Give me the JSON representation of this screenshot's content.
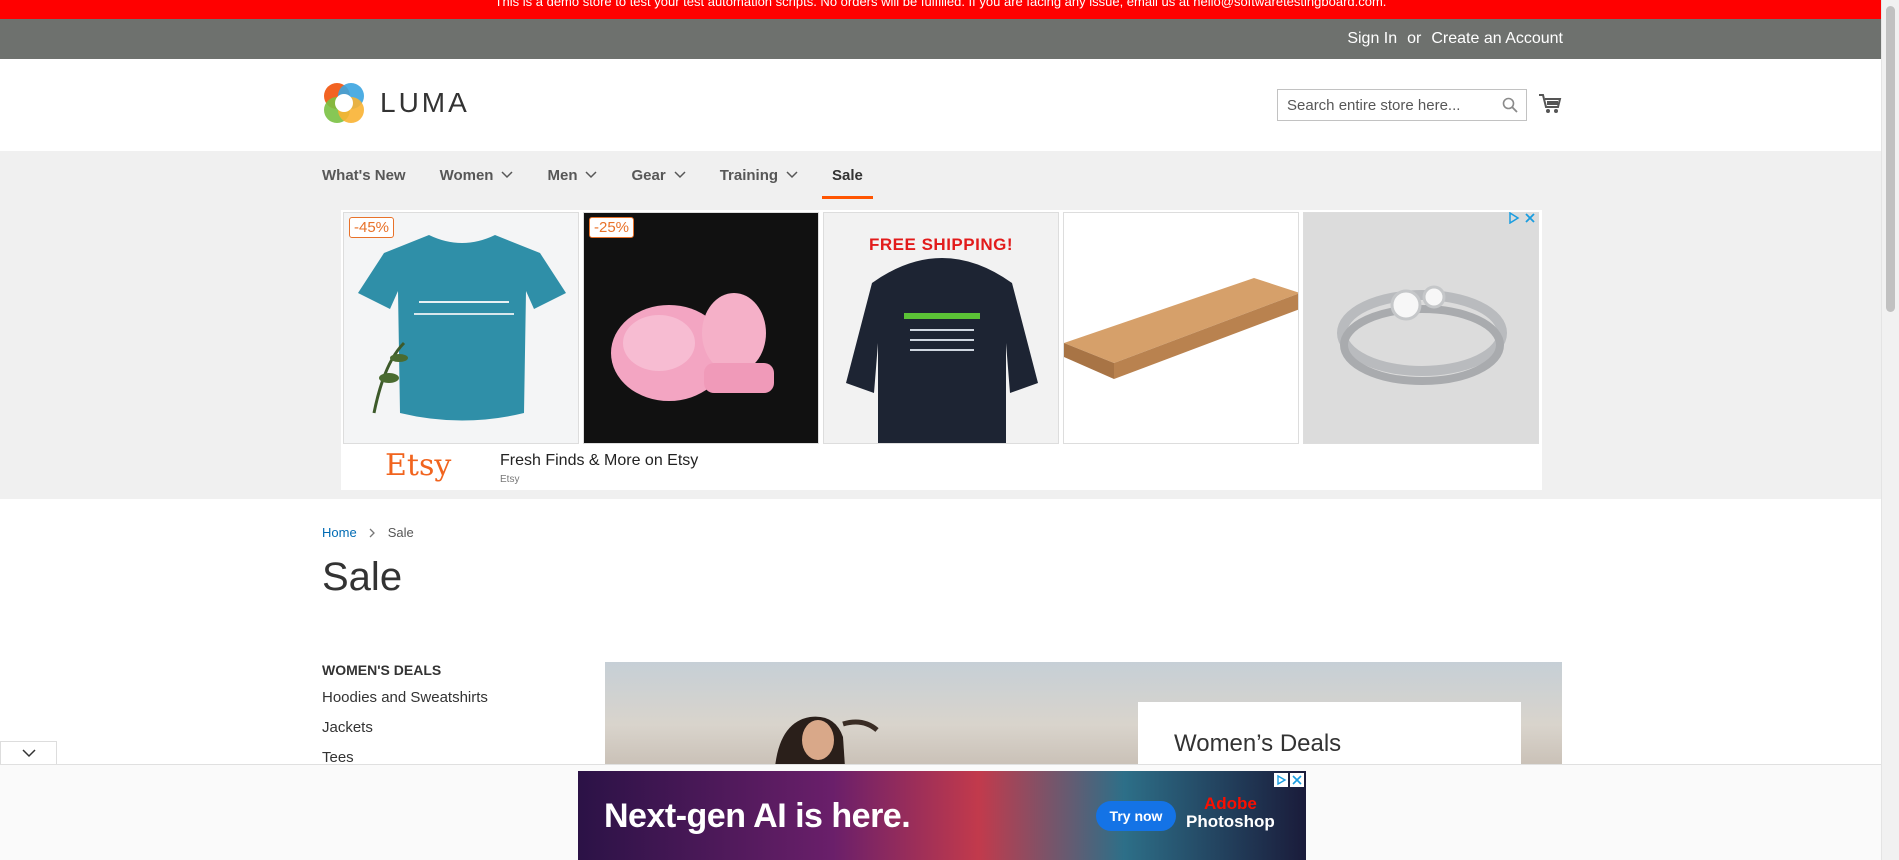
{
  "demo_notice": "This is a demo store to test your test automation scripts. No orders will be fulfilled. If you are facing any issue, email us at hello@softwaretestingboard.com.",
  "top_links": {
    "sign_in": "Sign In",
    "or": "or",
    "create_account": "Create an Account"
  },
  "header": {
    "logo_text": "LUMA",
    "search": {
      "placeholder": "Search entire store here...",
      "value": ""
    }
  },
  "nav": {
    "items": [
      {
        "label": "What's New",
        "dropdown": false
      },
      {
        "label": "Women",
        "dropdown": true
      },
      {
        "label": "Men",
        "dropdown": true
      },
      {
        "label": "Gear",
        "dropdown": true
      },
      {
        "label": "Training",
        "dropdown": true
      },
      {
        "label": "Sale",
        "dropdown": false,
        "active": true
      }
    ]
  },
  "ad": {
    "tiles": [
      {
        "badge": "-45%"
      },
      {
        "badge": "-25%"
      },
      {
        "overlay": "FREE SHIPPING!"
      },
      {},
      {}
    ],
    "brand": "Etsy",
    "title": "Fresh Finds & More on Etsy",
    "subtitle": "Etsy"
  },
  "breadcrumb": {
    "home": "Home",
    "current": "Sale"
  },
  "page_title": "Sale",
  "sidebar": {
    "heading": "WOMEN'S DEALS",
    "links": [
      "Hoodies and Sweatshirts",
      "Jackets",
      "Tees"
    ]
  },
  "hero": {
    "card_title": "Women’s Deals"
  },
  "bottom_ad": {
    "headline": "Next-gen AI is here.",
    "cta": "Try now",
    "brand_top": "Adobe",
    "brand_bottom": "Photoshop"
  },
  "colors": {
    "accent": "#ff5501",
    "demo_bar": "#ff0000",
    "link": "#006bb4",
    "etsy": "#f1641e"
  }
}
